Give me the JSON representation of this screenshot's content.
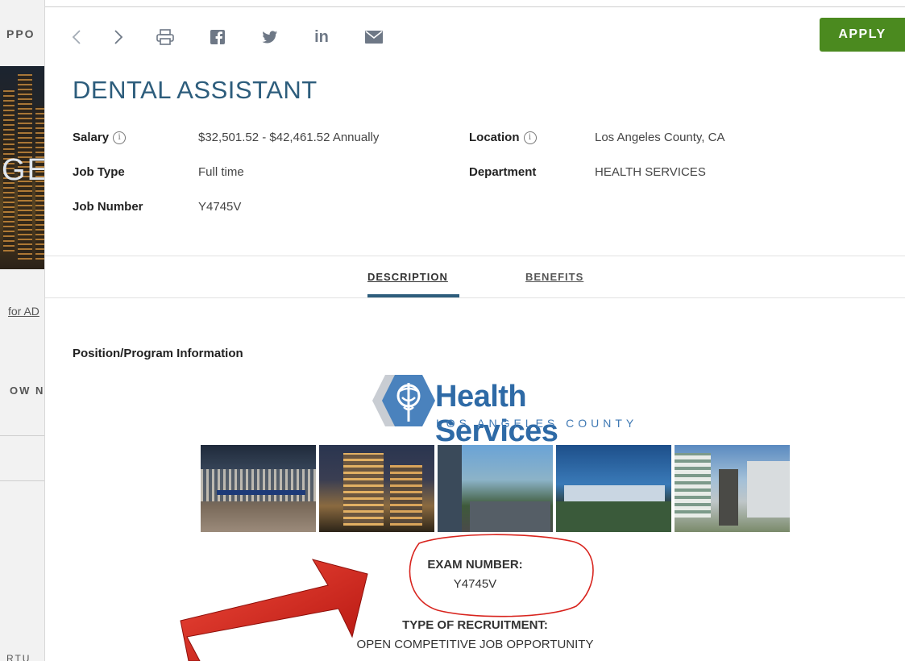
{
  "background_page": {
    "top_text": "PPO",
    "hero_text": "GE",
    "link_text": "for AD",
    "section_text": "OW N",
    "bottom_text": "RTU"
  },
  "toolbar": {
    "prev_icon": "chevron-left-icon",
    "next_icon": "chevron-right-icon",
    "print_icon": "print-icon",
    "facebook_icon": "facebook-icon",
    "twitter_icon": "twitter-icon",
    "linkedin_icon": "linkedin-icon",
    "email_icon": "email-icon",
    "apply_label": "APPLY"
  },
  "job": {
    "title": "DENTAL ASSISTANT",
    "salary_label": "Salary",
    "salary_value": "$32,501.52 - $42,461.52 Annually",
    "location_label": "Location",
    "location_value": "Los Angeles County, CA",
    "job_type_label": "Job Type",
    "job_type_value": "Full time",
    "department_label": "Department",
    "department_value": "HEALTH SERVICES",
    "job_number_label": "Job Number",
    "job_number_value": "Y4745V"
  },
  "tabs": [
    {
      "label": "DESCRIPTION",
      "active": true
    },
    {
      "label": "BENEFITS",
      "active": false
    }
  ],
  "description": {
    "heading": "Position/Program Information",
    "logo_wordmark": "Health Services",
    "logo_subtitle": "LOS ANGELES COUNTY",
    "exam_label": "EXAM NUMBER:",
    "exam_value": "Y4745V",
    "recruitment_label": "TYPE OF RECRUITMENT:",
    "recruitment_value": "OPEN COMPETITIVE JOB OPPORTUNITY"
  },
  "colors": {
    "title_blue": "#2d5d7c",
    "apply_green": "#4b8a1f",
    "annotation_red": "#d8241e"
  }
}
